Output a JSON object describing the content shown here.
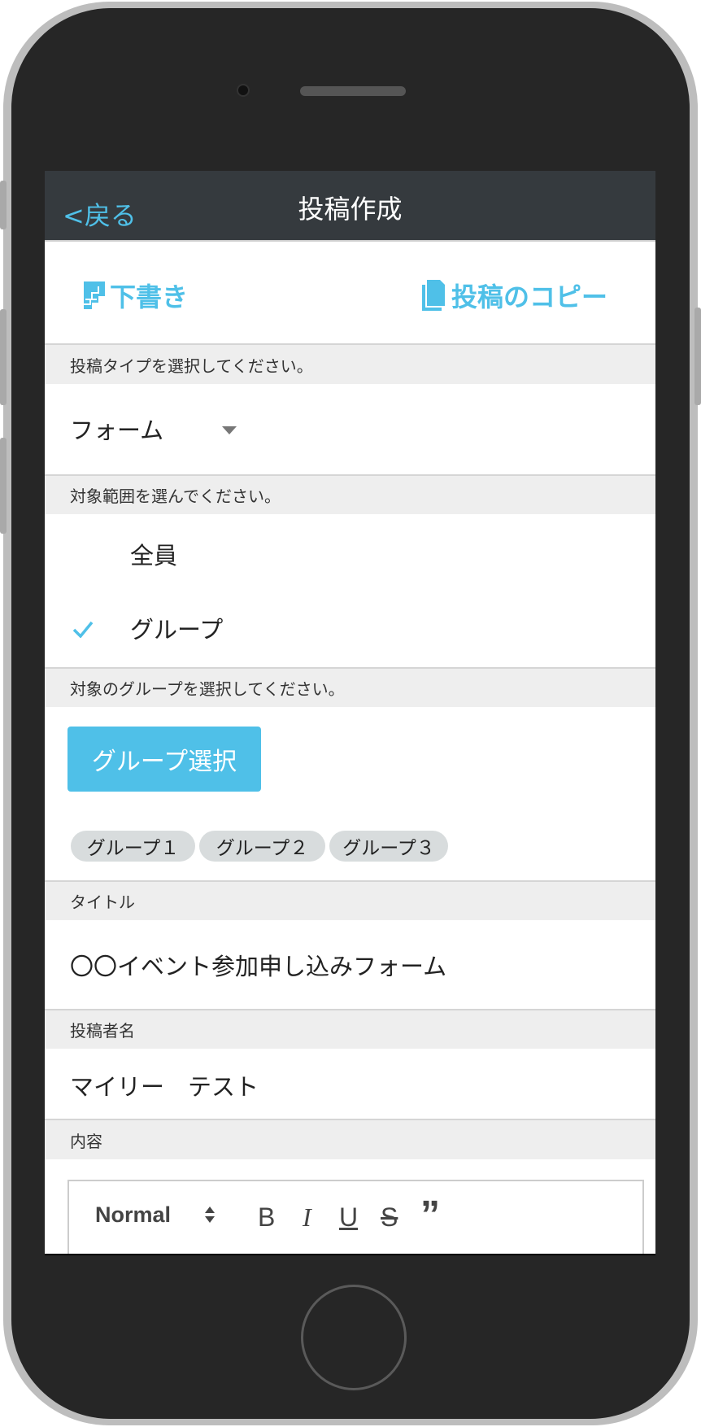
{
  "nav": {
    "back_label": "<戻る",
    "title": "投稿作成"
  },
  "toolbar": {
    "draft_label": "下書き",
    "copy_label": "投稿のコピー"
  },
  "post_type": {
    "header": "投稿タイプを選択してください。",
    "value": "フォーム"
  },
  "scope": {
    "header": "対象範囲を選んでください。",
    "options": [
      {
        "label": "全員",
        "selected": false
      },
      {
        "label": "グループ",
        "selected": true
      }
    ]
  },
  "groups": {
    "header": "対象のグループを選択してください。",
    "select_button": "グループ選択",
    "chips": [
      "グループ１",
      "グループ２",
      "グループ３"
    ]
  },
  "title_field": {
    "header": "タイトル",
    "value": "〇〇イベント参加申し込みフォーム"
  },
  "author_field": {
    "header": "投稿者名",
    "value": "マイリー　テスト"
  },
  "content": {
    "header": "内容",
    "format_select": "Normal",
    "tools": [
      "B",
      "I",
      "U",
      "S",
      "”"
    ]
  },
  "colors": {
    "accent": "#4fc0e8",
    "nav_bg": "#353a3e",
    "section_bg": "#eeeeee"
  }
}
